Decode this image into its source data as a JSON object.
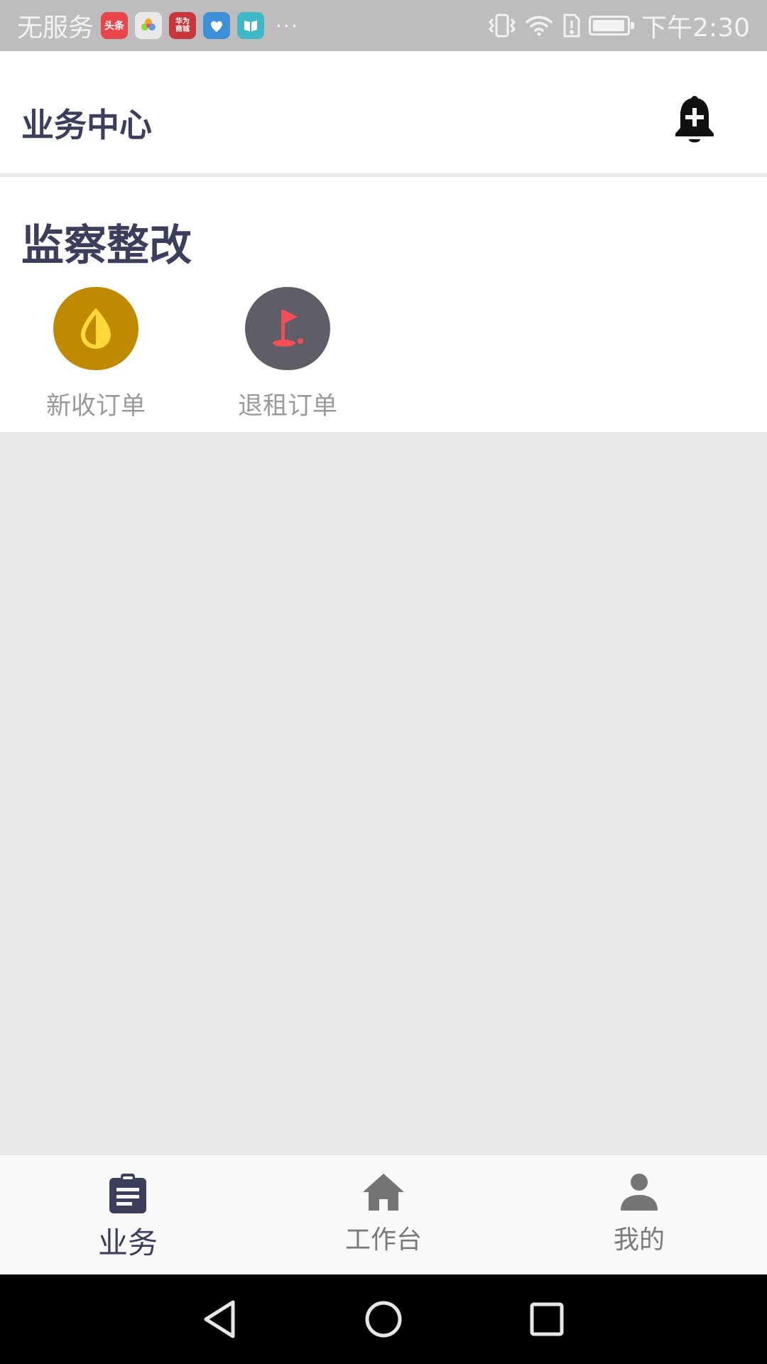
{
  "status_bar": {
    "carrier": "无服务",
    "app_icons": [
      {
        "name": "toutiao-icon",
        "text": "头条",
        "color": "#e8464a"
      },
      {
        "name": "gallery-icon",
        "text": "",
        "color": "#e8e8e8"
      },
      {
        "name": "huawei-mall-icon",
        "text": "华为商城",
        "color": "#c9363a"
      },
      {
        "name": "health-icon",
        "text": "",
        "color": "#3d8fd8"
      },
      {
        "name": "reader-icon",
        "text": "",
        "color": "#3fb8c8"
      }
    ],
    "more": "···",
    "battery_level": 0.95,
    "time": "下午2:30"
  },
  "header": {
    "title": "业务中心"
  },
  "section": {
    "title": "监察整改",
    "items": [
      {
        "label": "新收订单",
        "icon": "droplet-icon",
        "bg": "#c08a00",
        "fg": "#ffd83a"
      },
      {
        "label": "退租订单",
        "icon": "golf-flag-icon",
        "bg": "#5f5e66",
        "fg": "#f05055"
      }
    ]
  },
  "bottom_nav": {
    "items": [
      {
        "label": "业务",
        "icon": "clipboard-icon",
        "active": true
      },
      {
        "label": "工作台",
        "icon": "home-icon",
        "active": false
      },
      {
        "label": "我的",
        "icon": "person-icon",
        "active": false
      }
    ]
  },
  "colors": {
    "primary_text": "#3b3f5c",
    "muted_text": "#9a9a9a",
    "background": "#e9e9e9"
  }
}
